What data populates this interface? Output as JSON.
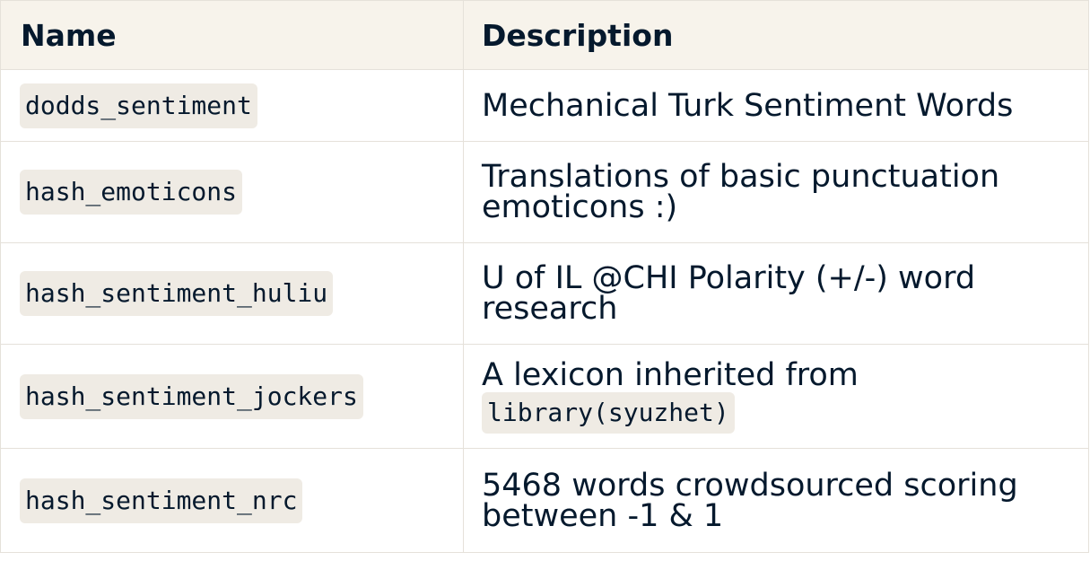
{
  "header": {
    "name": "Name",
    "description": "Description"
  },
  "rows": [
    {
      "name": "dodds_sentiment",
      "description": "Mechanical Turk Sentiment Words"
    },
    {
      "name": "hash_emoticons",
      "description": "Translations of basic punctuation emoticons :)"
    },
    {
      "name": "hash_sentiment_huliu",
      "description": "U of IL @CHI Polarity (+/-) word research"
    },
    {
      "name": "hash_sentiment_jockers",
      "description": "A lexicon inherited from",
      "description_code": "library(syuzhet)"
    },
    {
      "name": "hash_sentiment_nrc",
      "description": "5468 words crowdsourced scoring between -1 & 1"
    }
  ],
  "colors": {
    "text": "#05192d",
    "header_bg": "#f7f3eb",
    "code_bg": "#efebe4",
    "border": "#e5e1da"
  }
}
